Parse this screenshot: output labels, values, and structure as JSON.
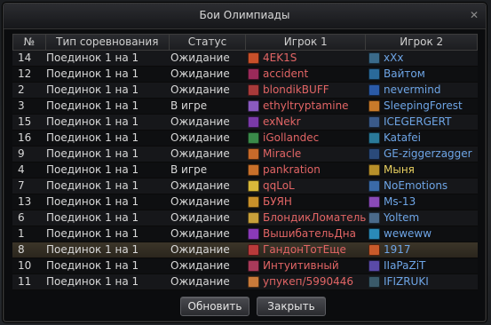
{
  "window": {
    "title": "Бои Олимпиады",
    "close_symbol": "✕"
  },
  "table": {
    "headers": [
      "№",
      "Тип соревнования",
      "Статус",
      "Игрок 1",
      "Игрок 2"
    ],
    "rows": [
      {
        "num": "14",
        "type": "Поединок 1 на 1",
        "status": "Ожидание",
        "p1": "4EK1S",
        "p2": "xXx",
        "p1_icon": "#c8502a",
        "p2_icon": "#3a6a8a"
      },
      {
        "num": "12",
        "type": "Поединок 1 на 1",
        "status": "Ожидание",
        "p1": "accident",
        "p2": "Вайтом",
        "p1_icon": "#9a2a5a",
        "p2_icon": "#2a6a9a"
      },
      {
        "num": "2",
        "type": "Поединок 1 на 1",
        "status": "Ожидание",
        "p1": "blondikBUFF",
        "p2": "nevermind",
        "p1_icon": "#a83a3a",
        "p2_icon": "#2a5aa8"
      },
      {
        "num": "3",
        "type": "Поединок 1 на 1",
        "status": "В игре",
        "p1": "ethyltryptamine",
        "p2": "SleepingForest",
        "p1_icon": "#8a5ac0",
        "p2_icon": "#c87a2a"
      },
      {
        "num": "15",
        "type": "Поединок 1 на 1",
        "status": "Ожидание",
        "p1": "exNekr",
        "p2": "ICEGERGERT",
        "p1_icon": "#7a3aa8",
        "p2_icon": "#3a5a8a"
      },
      {
        "num": "16",
        "type": "Поединок 1 на 1",
        "status": "Ожидание",
        "p1": "iGollandec",
        "p2": "Katafei",
        "p1_icon": "#3a8a4a",
        "p2_icon": "#2a7a9a"
      },
      {
        "num": "9",
        "type": "Поединок 1 на 1",
        "status": "Ожидание",
        "p1": "Miracle",
        "p2": "GE-ziggerzagger",
        "p1_icon": "#c86a2a",
        "p2_icon": "#2a4a7a"
      },
      {
        "num": "4",
        "type": "Поединок 1 на 1",
        "status": "В игре",
        "p1": "pankration",
        "p2": "Мыня",
        "p1_icon": "#c8702a",
        "p2_icon": "#b8902a"
      },
      {
        "num": "7",
        "type": "Поединок 1 на 1",
        "status": "Ожидание",
        "p1": "qqLoL",
        "p2": "NoEmotions",
        "p1_icon": "#d8b83a",
        "p2_icon": "#3a6aa8"
      },
      {
        "num": "13",
        "type": "Поединок 1 на 1",
        "status": "Ожидание",
        "p1": "БУЯН",
        "p2": "Ms-13",
        "p1_icon": "#c8902a",
        "p2_icon": "#8a4ab8"
      },
      {
        "num": "6",
        "type": "Поединок 1 на 1",
        "status": "Ожидание",
        "p1": "БлондикЛоматель",
        "p2": "Yoltem",
        "p1_icon": "#c8a03a",
        "p2_icon": "#4a6a8a"
      },
      {
        "num": "1",
        "type": "Поединок 1 на 1",
        "status": "Ожидание",
        "p1": "ВышибательДна",
        "p2": "weweww",
        "p1_icon": "#8a3ab8",
        "p2_icon": "#2a8ab8"
      },
      {
        "num": "8",
        "type": "Поединок 1 на 1",
        "status": "Ожидание",
        "p1": "ГандонТотЕще",
        "p2": "1917",
        "p1_icon": "#b83a3a",
        "p2_icon": "#c85a2a",
        "selected": true
      },
      {
        "num": "10",
        "type": "Поединок 1 на 1",
        "status": "Ожидание",
        "p1": "Интуитивный",
        "p2": "IIaPaZiT",
        "p1_icon": "#a83a5a",
        "p2_icon": "#5a4aa8"
      },
      {
        "num": "11",
        "type": "Поединок 1 на 1",
        "status": "Ожидание",
        "p1": "упукеп/5990446",
        "p2": "IFIZRUKI",
        "p1_icon": "#c87a3a",
        "p2_icon": "#3a5a6a"
      }
    ]
  },
  "buttons": {
    "refresh": "Обновить",
    "close": "Закрыть"
  },
  "colors": {
    "player1": "#e26565",
    "player2": "#6ea5e6",
    "highlight": "#e8d060"
  }
}
